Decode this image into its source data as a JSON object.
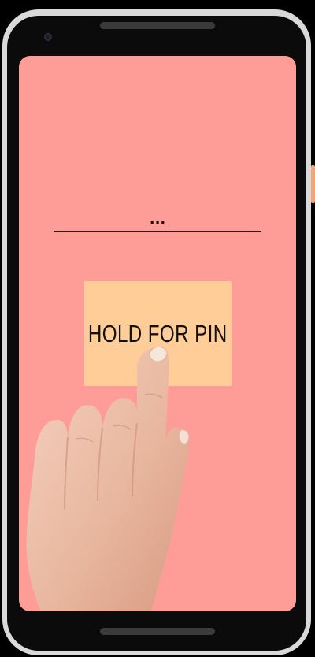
{
  "pin_entry": {
    "masked_value": "..."
  },
  "hold_button": {
    "label": "HOLD FOR PIN"
  },
  "icons": {
    "camera": "front-camera-icon",
    "hand": "pointing-hand-illustration"
  },
  "colors": {
    "screen_background": "#fe9d98",
    "button_background": "#ffce98",
    "text": "#111111",
    "phone_frame": "#d9d9d9"
  }
}
